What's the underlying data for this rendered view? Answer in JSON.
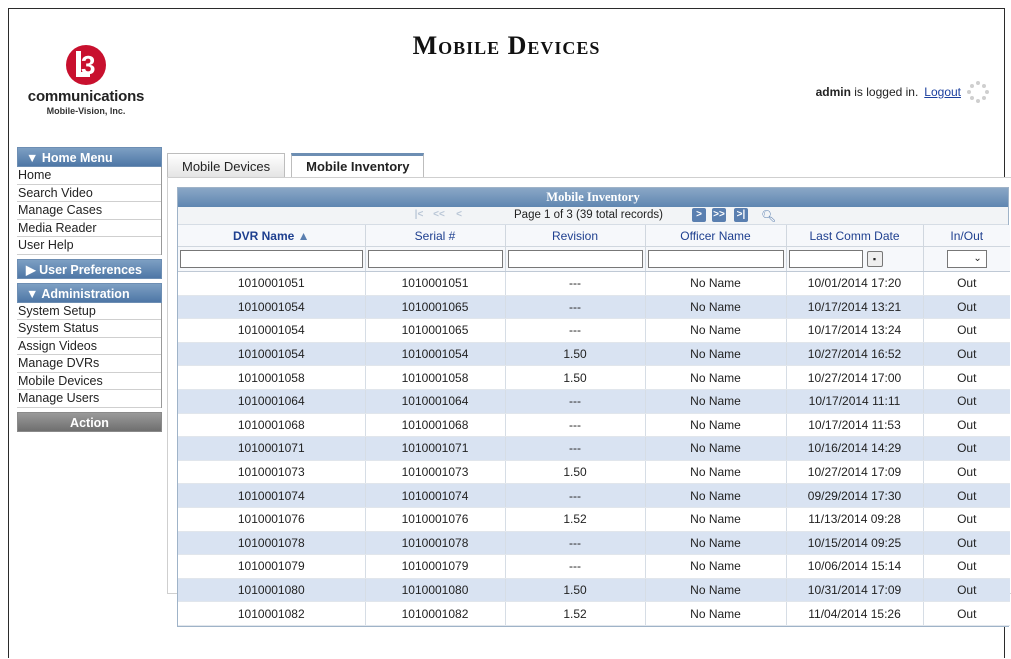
{
  "header": {
    "title": "Mobile Devices",
    "logo_name": "communications",
    "logo_sub": "Mobile-Vision, Inc.",
    "logo_mark": "L3",
    "user": "admin",
    "logged_in_text": "is logged in.",
    "logout_label": "Logout"
  },
  "sidebar": {
    "home_menu": "▼ Home Menu",
    "home_items": [
      "Home",
      "Search Video",
      "Manage Cases",
      "Media Reader",
      "User Help"
    ],
    "user_prefs": "▶ User Preferences",
    "administration": "▼ Administration",
    "admin_items": [
      "System Setup",
      "System Status",
      "Assign Videos",
      "Manage DVRs",
      "Mobile Devices",
      "Manage Users"
    ],
    "action": "Action"
  },
  "tabs": [
    "Mobile Devices",
    "Mobile Inventory"
  ],
  "grid": {
    "title": "Mobile Inventory",
    "pager_text": "Page 1 of 3 (39 total records)",
    "columns": [
      "DVR Name",
      "Serial #",
      "Revision",
      "Officer Name",
      "Last Comm Date",
      "In/Out"
    ],
    "sort_indicator": "▲",
    "rows": [
      [
        "1010001051",
        "1010001051",
        "---",
        "No Name",
        "10/01/2014 17:20",
        "Out"
      ],
      [
        "1010001054",
        "1010001065",
        "---",
        "No Name",
        "10/17/2014 13:21",
        "Out"
      ],
      [
        "1010001054",
        "1010001065",
        "---",
        "No Name",
        "10/17/2014 13:24",
        "Out"
      ],
      [
        "1010001054",
        "1010001054",
        "1.50",
        "No Name",
        "10/27/2014 16:52",
        "Out"
      ],
      [
        "1010001058",
        "1010001058",
        "1.50",
        "No Name",
        "10/27/2014 17:00",
        "Out"
      ],
      [
        "1010001064",
        "1010001064",
        "---",
        "No Name",
        "10/17/2014 11:11",
        "Out"
      ],
      [
        "1010001068",
        "1010001068",
        "---",
        "No Name",
        "10/17/2014 11:53",
        "Out"
      ],
      [
        "1010001071",
        "1010001071",
        "---",
        "No Name",
        "10/16/2014 14:29",
        "Out"
      ],
      [
        "1010001073",
        "1010001073",
        "1.50",
        "No Name",
        "10/27/2014 17:09",
        "Out"
      ],
      [
        "1010001074",
        "1010001074",
        "---",
        "No Name",
        "09/29/2014 17:30",
        "Out"
      ],
      [
        "1010001076",
        "1010001076",
        "1.52",
        "No Name",
        "11/13/2014 09:28",
        "Out"
      ],
      [
        "1010001078",
        "1010001078",
        "---",
        "No Name",
        "10/15/2014 09:25",
        "Out"
      ],
      [
        "1010001079",
        "1010001079",
        "---",
        "No Name",
        "10/06/2014 15:14",
        "Out"
      ],
      [
        "1010001080",
        "1010001080",
        "1.50",
        "No Name",
        "10/31/2014 17:09",
        "Out"
      ],
      [
        "1010001082",
        "1010001082",
        "1.52",
        "No Name",
        "11/04/2014 15:26",
        "Out"
      ]
    ]
  },
  "colors": {
    "header_blue": "#5f86b1",
    "row_stripe": "#d9e3f2",
    "link": "#1b3f9e",
    "logo_red": "#c8102e"
  }
}
